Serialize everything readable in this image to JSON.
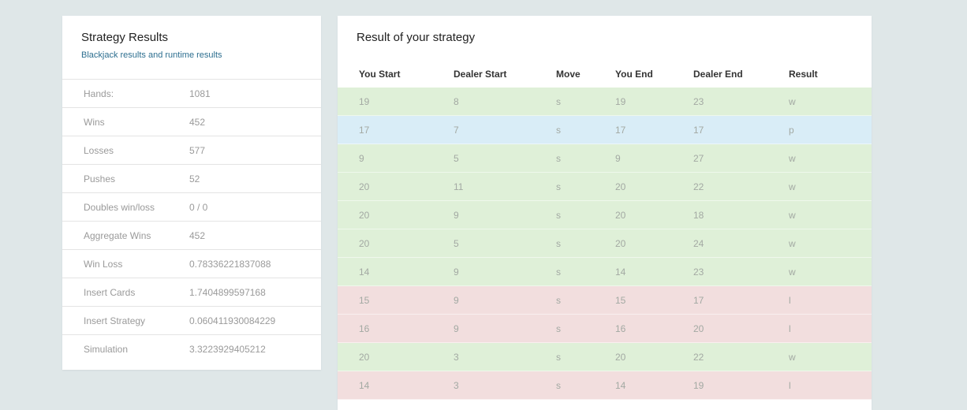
{
  "left_panel": {
    "title": "Strategy Results",
    "subtitle": "Blackjack results and runtime results",
    "stats": [
      {
        "label": "Hands:",
        "value": "1081"
      },
      {
        "label": "Wins",
        "value": "452"
      },
      {
        "label": "Losses",
        "value": "577"
      },
      {
        "label": "Pushes",
        "value": "52"
      },
      {
        "label": "Doubles win/loss",
        "value": "0 / 0"
      },
      {
        "label": "Aggregate Wins",
        "value": "452"
      },
      {
        "label": "Win Loss",
        "value": "0.78336221837088"
      },
      {
        "label": "Insert Cards",
        "value": "1.7404899597168"
      },
      {
        "label": "Insert Strategy",
        "value": "0.060411930084229"
      },
      {
        "label": "Simulation",
        "value": "3.3223929405212"
      }
    ]
  },
  "right_panel": {
    "title": "Result of your strategy",
    "columns": [
      "You Start",
      "Dealer Start",
      "Move",
      "You End",
      "Dealer End",
      "Result"
    ],
    "rows": [
      [
        "19",
        "8",
        "s",
        "19",
        "23",
        "w"
      ],
      [
        "17",
        "7",
        "s",
        "17",
        "17",
        "p"
      ],
      [
        "9",
        "5",
        "s",
        "9",
        "27",
        "w"
      ],
      [
        "20",
        "11",
        "s",
        "20",
        "22",
        "w"
      ],
      [
        "20",
        "9",
        "s",
        "20",
        "18",
        "w"
      ],
      [
        "20",
        "5",
        "s",
        "20",
        "24",
        "w"
      ],
      [
        "14",
        "9",
        "s",
        "14",
        "23",
        "w"
      ],
      [
        "15",
        "9",
        "s",
        "15",
        "17",
        "l"
      ],
      [
        "16",
        "9",
        "s",
        "16",
        "20",
        "l"
      ],
      [
        "20",
        "3",
        "s",
        "20",
        "22",
        "w"
      ],
      [
        "14",
        "3",
        "s",
        "14",
        "19",
        "l"
      ]
    ]
  },
  "colors": {
    "background": "#dfe7e8",
    "win_row": "#dff0d8",
    "push_row": "#d9edf7",
    "loss_row": "#f2dede",
    "subtitle": "#2c6e8f"
  }
}
